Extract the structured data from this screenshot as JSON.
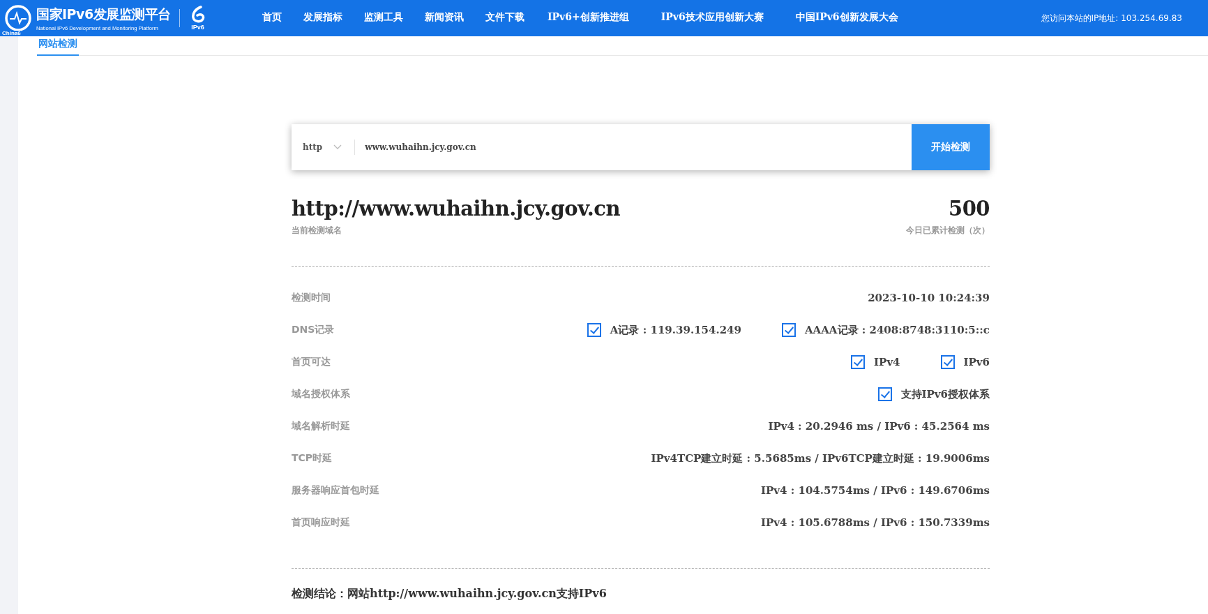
{
  "header": {
    "logo_title": "国家IPv6发展监测平台",
    "logo_subtitle": "National IPv6 Development and Monitoring Platform",
    "logo_caption": "China6",
    "badge_text": "IPv6",
    "nav": [
      {
        "label": "首页",
        "selected": false
      },
      {
        "label": "发展指标",
        "selected": false
      },
      {
        "label": "监测工具",
        "selected": false
      },
      {
        "label": "新闻资讯",
        "selected": false
      },
      {
        "label": "文件下载",
        "selected": false
      },
      {
        "label": "IPv6+创新推进组",
        "selected": false
      },
      {
        "label": "IPv6技术应用创新大赛",
        "selected": false
      },
      {
        "label": "中国IPv6创新发展大会",
        "selected": false
      }
    ],
    "ip_notice": "您访问本站的IP地址: 103.254.69.83"
  },
  "tabs": [
    {
      "label": "网站检测",
      "selected": true
    }
  ],
  "search": {
    "protocol": "http",
    "value": "www.wuhaihn.jcy.gov.cn",
    "button": "开始检测"
  },
  "summary": {
    "domain": "http://www.wuhaihn.jcy.gov.cn",
    "domain_caption": "当前检测域名",
    "count": "500",
    "count_caption": "今日已累计检测（次）"
  },
  "rows": [
    {
      "label": "检测时间",
      "kind": "text",
      "value": "2023-10-10 10:24:39"
    },
    {
      "label": "DNS记录",
      "kind": "checks",
      "items": [
        {
          "label": "A记录 : 119.39.154.249",
          "checked": true
        },
        {
          "label": "AAAA记录 : 2408:8748:3110:5::c",
          "checked": true
        }
      ]
    },
    {
      "label": "首页可达",
      "kind": "checks",
      "items": [
        {
          "label": "IPv4",
          "checked": true
        },
        {
          "label": "IPv6",
          "checked": true
        }
      ]
    },
    {
      "label": "域名授权体系",
      "kind": "checks",
      "items": [
        {
          "label": "支持IPv6授权体系",
          "checked": true
        }
      ]
    },
    {
      "label": "域名解析时延",
      "kind": "text",
      "value": "IPv4 : 20.2946 ms / IPv6 : 45.2564 ms"
    },
    {
      "label": "TCP时延",
      "kind": "text",
      "value": "IPv4TCP建立时延 : 5.5685ms / IPv6TCP建立时延 : 19.9006ms"
    },
    {
      "label": "服务器响应首包时延",
      "kind": "text",
      "value": "IPv4 : 104.5754ms / IPv6 : 149.6706ms"
    },
    {
      "label": "首页响应时延",
      "kind": "text",
      "value": "IPv4 : 105.6788ms / IPv6 : 150.7339ms"
    }
  ],
  "conclusion": "检测结论：网站http://www.wuhaihn.jcy.gov.cn支持IPv6"
}
